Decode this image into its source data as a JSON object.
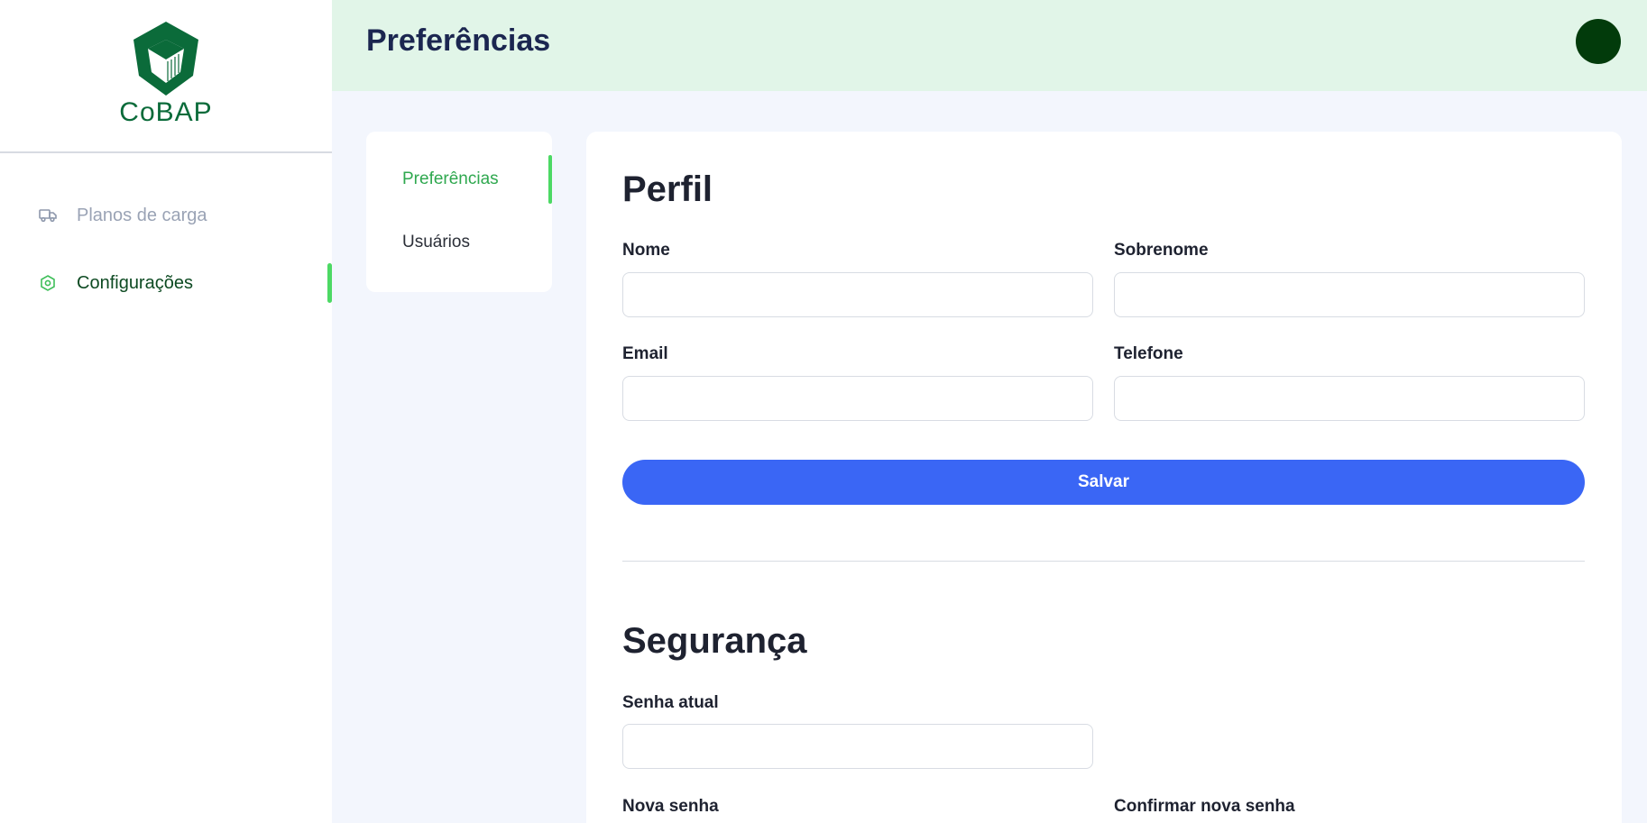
{
  "brand": {
    "name": "CoBAP",
    "color": "#0b6b3a"
  },
  "sidebar": {
    "items": [
      {
        "label": "Planos de carga",
        "icon": "truck-icon",
        "active": false
      },
      {
        "label": "Configurações",
        "icon": "hexagon-gear-icon",
        "active": true
      }
    ]
  },
  "header": {
    "title": "Preferências",
    "avatar_color": "#023b0b"
  },
  "submenu": {
    "items": [
      {
        "label": "Preferências",
        "active": true
      },
      {
        "label": "Usuários",
        "active": false
      }
    ]
  },
  "profile": {
    "title": "Perfil",
    "fields": {
      "first_name": {
        "label": "Nome",
        "value": ""
      },
      "last_name": {
        "label": "Sobrenome",
        "value": ""
      },
      "email": {
        "label": "Email",
        "value": ""
      },
      "phone": {
        "label": "Telefone",
        "value": ""
      }
    },
    "save_label": "Salvar"
  },
  "security": {
    "title": "Segurança",
    "fields": {
      "current_password": {
        "label": "Senha atual",
        "value": ""
      },
      "new_password": {
        "label": "Nova senha",
        "value": ""
      },
      "confirm_password": {
        "label": "Confirmar nova senha",
        "value": ""
      }
    }
  },
  "colors": {
    "accent_green": "#4cd964",
    "primary_blue": "#3a66f5",
    "header_bg": "#e1f5e8",
    "title_navy": "#1b2650"
  }
}
